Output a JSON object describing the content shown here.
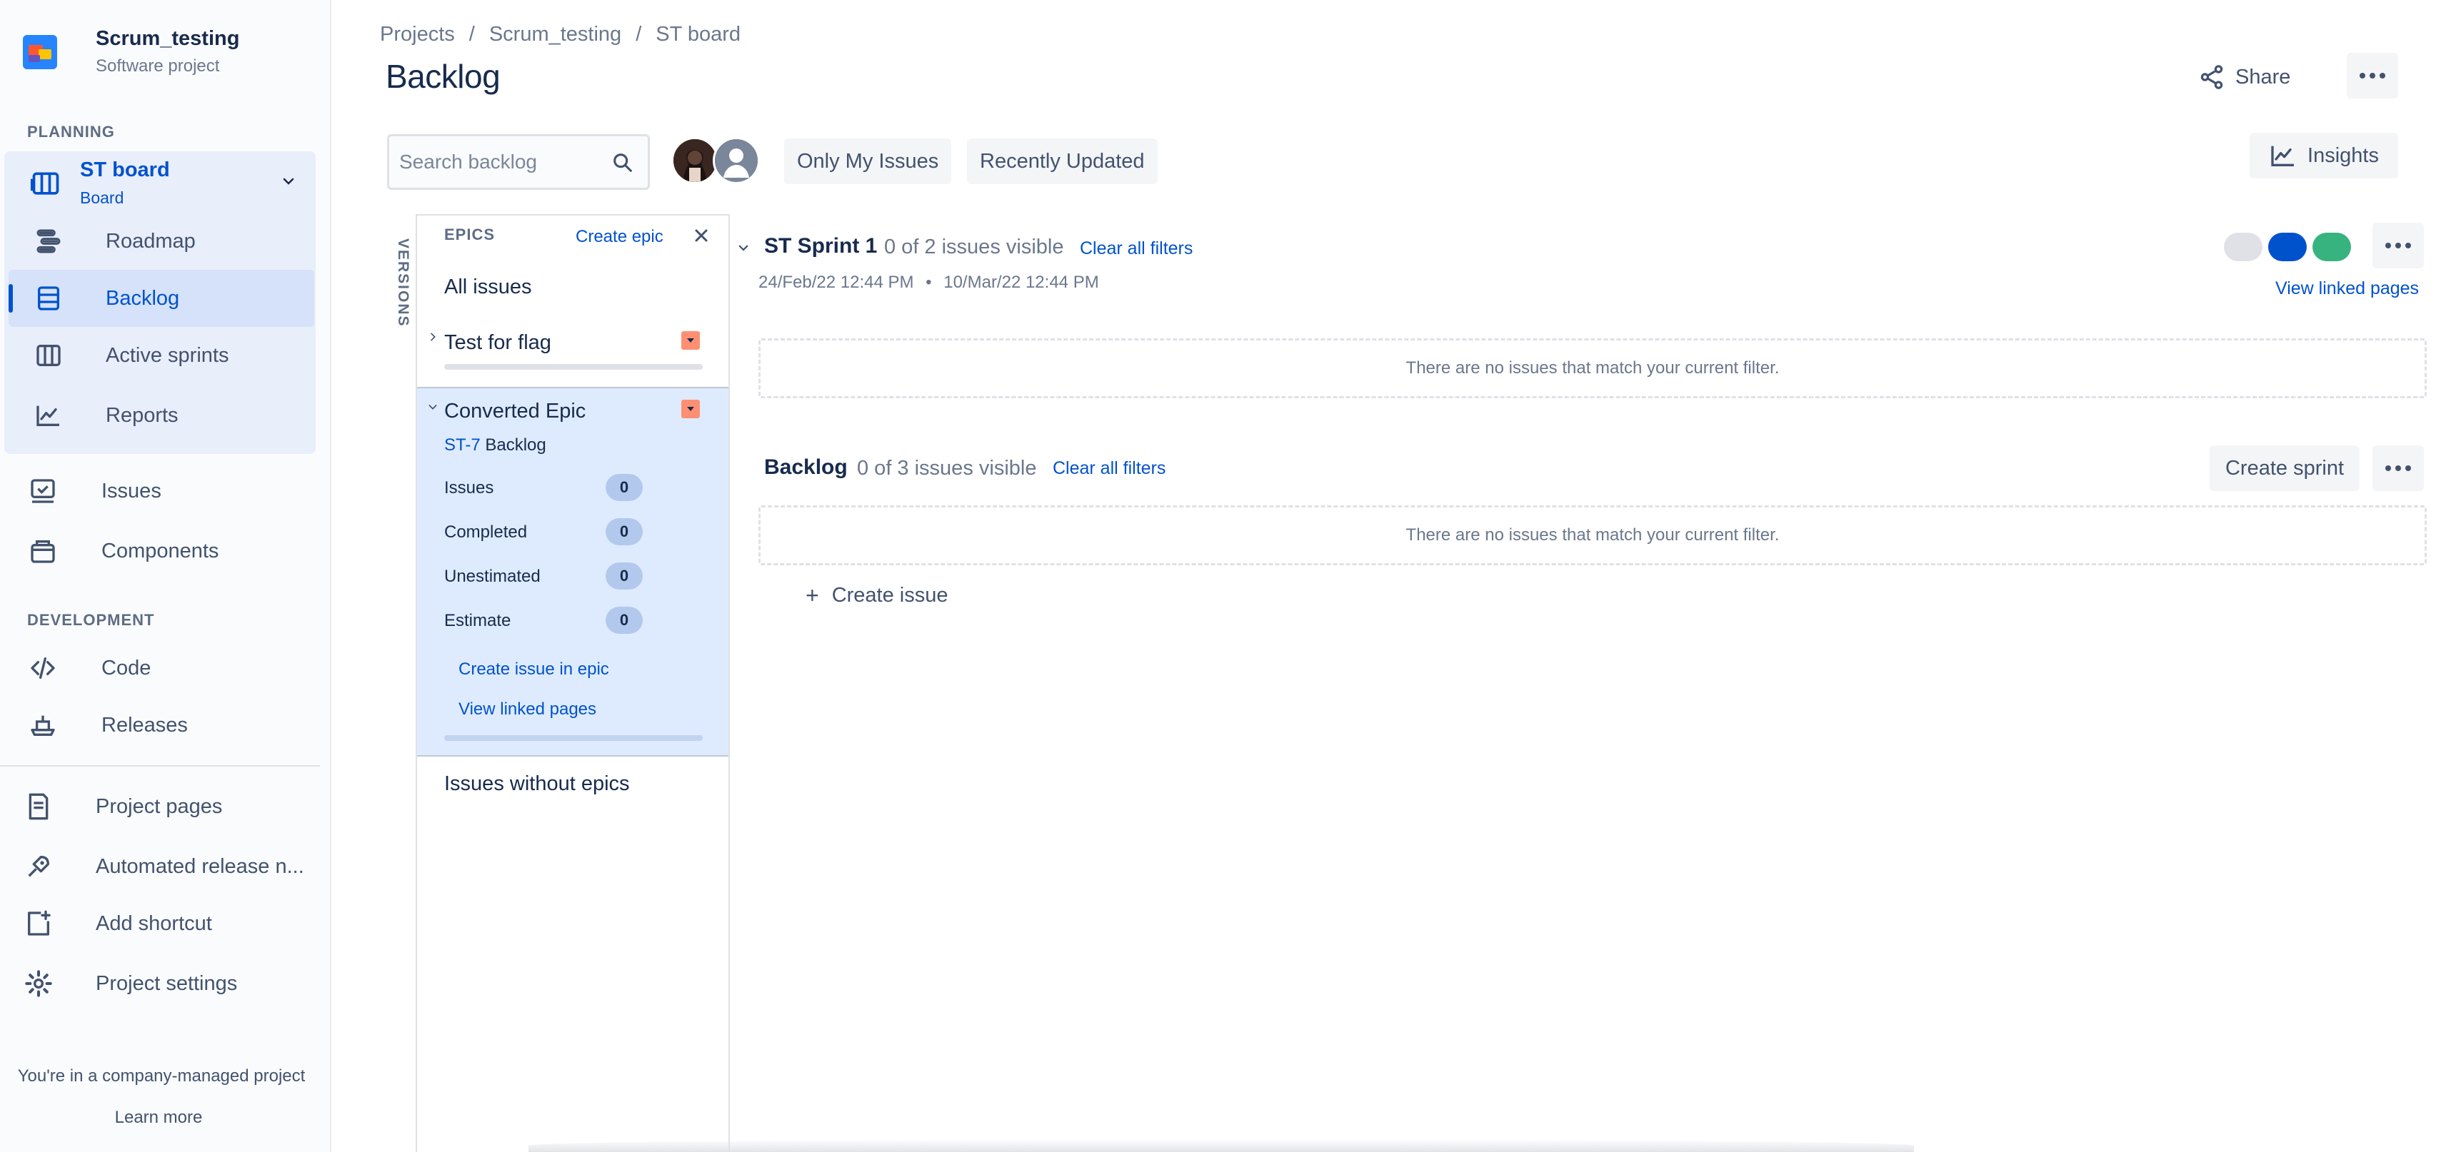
{
  "project": {
    "name": "Scrum_testing",
    "type": "Software project"
  },
  "sidebar": {
    "planning_label": "PLANNING",
    "board": {
      "title": "ST board",
      "subtitle": "Board"
    },
    "planning_items": [
      {
        "label": "Roadmap",
        "icon": "roadmap-icon"
      },
      {
        "label": "Backlog",
        "icon": "backlog-icon",
        "active": true
      },
      {
        "label": "Active sprints",
        "icon": "active-sprints-icon"
      },
      {
        "label": "Reports",
        "icon": "reports-icon"
      }
    ],
    "items": [
      {
        "label": "Issues",
        "icon": "issues-icon"
      },
      {
        "label": "Components",
        "icon": "components-icon"
      }
    ],
    "development_label": "DEVELOPMENT",
    "dev_items": [
      {
        "label": "Code",
        "icon": "code-icon"
      },
      {
        "label": "Releases",
        "icon": "releases-icon"
      }
    ],
    "footer_items": [
      {
        "label": "Project pages",
        "icon": "project-pages-icon"
      },
      {
        "label": "Automated release n...",
        "icon": "automated-release-icon"
      },
      {
        "label": "Add shortcut",
        "icon": "add-shortcut-icon"
      },
      {
        "label": "Project settings",
        "icon": "gear-icon"
      }
    ],
    "company_note": "You're in a company-managed project",
    "learn_more": "Learn more"
  },
  "breadcrumb": [
    "Projects",
    "Scrum_testing",
    "ST board"
  ],
  "page_title": "Backlog",
  "header": {
    "share_label": "Share"
  },
  "toolbar": {
    "search_placeholder": "Search backlog",
    "quick_filters": [
      "Only My Issues",
      "Recently Updated"
    ],
    "insights_label": "Insights"
  },
  "versions_label": "VERSIONS",
  "epics": {
    "header": "EPICS",
    "create_epic": "Create epic",
    "all_issues": "All issues",
    "list": [
      {
        "name": "Test for flag",
        "color": "#ff8f73"
      },
      {
        "name": "Converted Epic",
        "color": "#ff8f73",
        "key": "ST-7",
        "status": "Backlog",
        "stats": [
          {
            "label": "Issues",
            "value": "0"
          },
          {
            "label": "Completed",
            "value": "0"
          },
          {
            "label": "Unestimated",
            "value": "0"
          },
          {
            "label": "Estimate",
            "value": "0"
          }
        ],
        "create_issue_link": "Create issue in epic",
        "view_linked_link": "View linked pages"
      }
    ],
    "issues_without_epics": "Issues without epics"
  },
  "sprint": {
    "name": "ST Sprint 1",
    "visible_count": "0 of 2 issues visible",
    "clear_filters": "Clear all filters",
    "start_date": "24/Feb/22 12:44 PM",
    "date_separator": "•",
    "end_date": "10/Mar/22 12:44 PM",
    "status_colors": [
      "#dfe1e6",
      "#0052cc",
      "#36b37e"
    ],
    "view_linked_pages": "View linked pages",
    "empty_message": "There are no issues that match your current filter."
  },
  "backlog": {
    "title": "Backlog",
    "visible_count": "0 of 3 issues visible",
    "clear_filters": "Clear all filters",
    "create_sprint": "Create sprint",
    "empty_message": "There are no issues that match your current filter.",
    "create_issue": "Create issue"
  }
}
